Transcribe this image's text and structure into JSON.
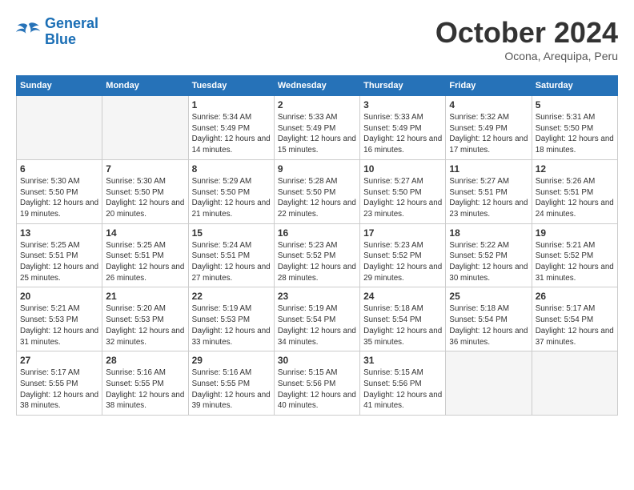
{
  "header": {
    "logo_line1": "General",
    "logo_line2": "Blue",
    "month": "October 2024",
    "location": "Ocona, Arequipa, Peru"
  },
  "days_of_week": [
    "Sunday",
    "Monday",
    "Tuesday",
    "Wednesday",
    "Thursday",
    "Friday",
    "Saturday"
  ],
  "weeks": [
    [
      {
        "day": "",
        "info": ""
      },
      {
        "day": "",
        "info": ""
      },
      {
        "day": "1",
        "info": "Sunrise: 5:34 AM\nSunset: 5:49 PM\nDaylight: 12 hours and 14 minutes."
      },
      {
        "day": "2",
        "info": "Sunrise: 5:33 AM\nSunset: 5:49 PM\nDaylight: 12 hours and 15 minutes."
      },
      {
        "day": "3",
        "info": "Sunrise: 5:33 AM\nSunset: 5:49 PM\nDaylight: 12 hours and 16 minutes."
      },
      {
        "day": "4",
        "info": "Sunrise: 5:32 AM\nSunset: 5:49 PM\nDaylight: 12 hours and 17 minutes."
      },
      {
        "day": "5",
        "info": "Sunrise: 5:31 AM\nSunset: 5:50 PM\nDaylight: 12 hours and 18 minutes."
      }
    ],
    [
      {
        "day": "6",
        "info": "Sunrise: 5:30 AM\nSunset: 5:50 PM\nDaylight: 12 hours and 19 minutes."
      },
      {
        "day": "7",
        "info": "Sunrise: 5:30 AM\nSunset: 5:50 PM\nDaylight: 12 hours and 20 minutes."
      },
      {
        "day": "8",
        "info": "Sunrise: 5:29 AM\nSunset: 5:50 PM\nDaylight: 12 hours and 21 minutes."
      },
      {
        "day": "9",
        "info": "Sunrise: 5:28 AM\nSunset: 5:50 PM\nDaylight: 12 hours and 22 minutes."
      },
      {
        "day": "10",
        "info": "Sunrise: 5:27 AM\nSunset: 5:50 PM\nDaylight: 12 hours and 23 minutes."
      },
      {
        "day": "11",
        "info": "Sunrise: 5:27 AM\nSunset: 5:51 PM\nDaylight: 12 hours and 23 minutes."
      },
      {
        "day": "12",
        "info": "Sunrise: 5:26 AM\nSunset: 5:51 PM\nDaylight: 12 hours and 24 minutes."
      }
    ],
    [
      {
        "day": "13",
        "info": "Sunrise: 5:25 AM\nSunset: 5:51 PM\nDaylight: 12 hours and 25 minutes."
      },
      {
        "day": "14",
        "info": "Sunrise: 5:25 AM\nSunset: 5:51 PM\nDaylight: 12 hours and 26 minutes."
      },
      {
        "day": "15",
        "info": "Sunrise: 5:24 AM\nSunset: 5:51 PM\nDaylight: 12 hours and 27 minutes."
      },
      {
        "day": "16",
        "info": "Sunrise: 5:23 AM\nSunset: 5:52 PM\nDaylight: 12 hours and 28 minutes."
      },
      {
        "day": "17",
        "info": "Sunrise: 5:23 AM\nSunset: 5:52 PM\nDaylight: 12 hours and 29 minutes."
      },
      {
        "day": "18",
        "info": "Sunrise: 5:22 AM\nSunset: 5:52 PM\nDaylight: 12 hours and 30 minutes."
      },
      {
        "day": "19",
        "info": "Sunrise: 5:21 AM\nSunset: 5:52 PM\nDaylight: 12 hours and 31 minutes."
      }
    ],
    [
      {
        "day": "20",
        "info": "Sunrise: 5:21 AM\nSunset: 5:53 PM\nDaylight: 12 hours and 31 minutes."
      },
      {
        "day": "21",
        "info": "Sunrise: 5:20 AM\nSunset: 5:53 PM\nDaylight: 12 hours and 32 minutes."
      },
      {
        "day": "22",
        "info": "Sunrise: 5:19 AM\nSunset: 5:53 PM\nDaylight: 12 hours and 33 minutes."
      },
      {
        "day": "23",
        "info": "Sunrise: 5:19 AM\nSunset: 5:54 PM\nDaylight: 12 hours and 34 minutes."
      },
      {
        "day": "24",
        "info": "Sunrise: 5:18 AM\nSunset: 5:54 PM\nDaylight: 12 hours and 35 minutes."
      },
      {
        "day": "25",
        "info": "Sunrise: 5:18 AM\nSunset: 5:54 PM\nDaylight: 12 hours and 36 minutes."
      },
      {
        "day": "26",
        "info": "Sunrise: 5:17 AM\nSunset: 5:54 PM\nDaylight: 12 hours and 37 minutes."
      }
    ],
    [
      {
        "day": "27",
        "info": "Sunrise: 5:17 AM\nSunset: 5:55 PM\nDaylight: 12 hours and 38 minutes."
      },
      {
        "day": "28",
        "info": "Sunrise: 5:16 AM\nSunset: 5:55 PM\nDaylight: 12 hours and 38 minutes."
      },
      {
        "day": "29",
        "info": "Sunrise: 5:16 AM\nSunset: 5:55 PM\nDaylight: 12 hours and 39 minutes."
      },
      {
        "day": "30",
        "info": "Sunrise: 5:15 AM\nSunset: 5:56 PM\nDaylight: 12 hours and 40 minutes."
      },
      {
        "day": "31",
        "info": "Sunrise: 5:15 AM\nSunset: 5:56 PM\nDaylight: 12 hours and 41 minutes."
      },
      {
        "day": "",
        "info": ""
      },
      {
        "day": "",
        "info": ""
      }
    ]
  ]
}
